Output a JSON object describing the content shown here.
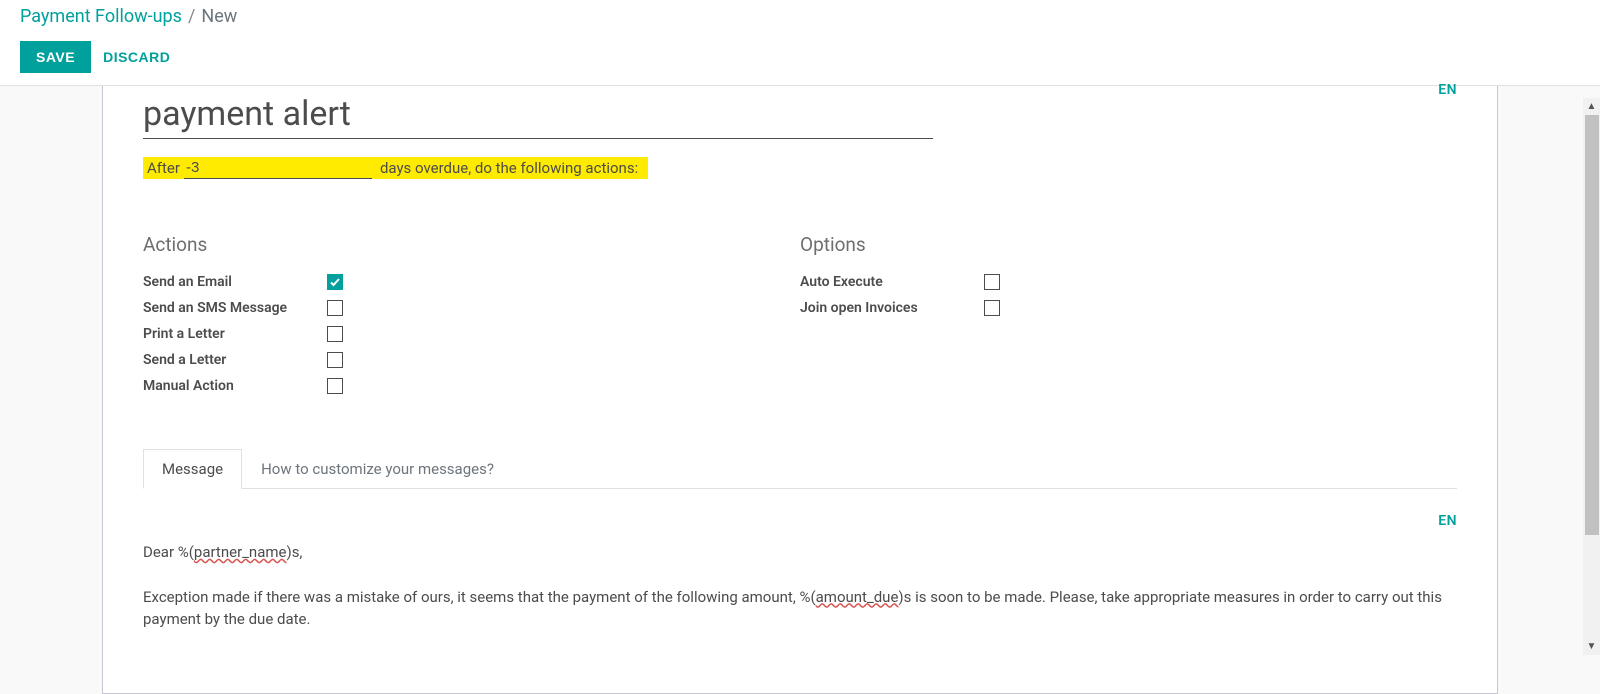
{
  "breadcrumb": {
    "root": "Payment Follow-ups",
    "sep": "/",
    "current": "New"
  },
  "buttons": {
    "save": "SAVE",
    "discard": "DISCARD"
  },
  "lang_badge": "EN",
  "record": {
    "name": "payment alert",
    "after": {
      "prefix": "After",
      "days": "-3",
      "suffix": "days overdue, do the following actions:"
    }
  },
  "sections": {
    "actions": {
      "heading": "Actions",
      "send_email": {
        "label": "Send an Email",
        "checked": true
      },
      "send_sms": {
        "label": "Send an SMS Message",
        "checked": false
      },
      "print_letter": {
        "label": "Print a Letter",
        "checked": false
      },
      "send_letter": {
        "label": "Send a Letter",
        "checked": false
      },
      "manual_action": {
        "label": "Manual Action",
        "checked": false
      }
    },
    "options": {
      "heading": "Options",
      "auto_execute": {
        "label": "Auto Execute",
        "checked": false
      },
      "join_invoices": {
        "label": "Join open Invoices",
        "checked": false
      }
    }
  },
  "tabs": {
    "message": "Message",
    "howto": "How to customize your messages?"
  },
  "message": {
    "greeting_pre": "Dear %(",
    "greeting_var": "partner_name",
    "greeting_post": ")s,",
    "body_pre": "Exception made if there was a mistake of ours, it seems that the payment of  the following amount, %(",
    "body_var": "amount_due",
    "body_post": ")s is soon to be made. Please, take appropriate measures in order to carry out this payment by the due date."
  }
}
